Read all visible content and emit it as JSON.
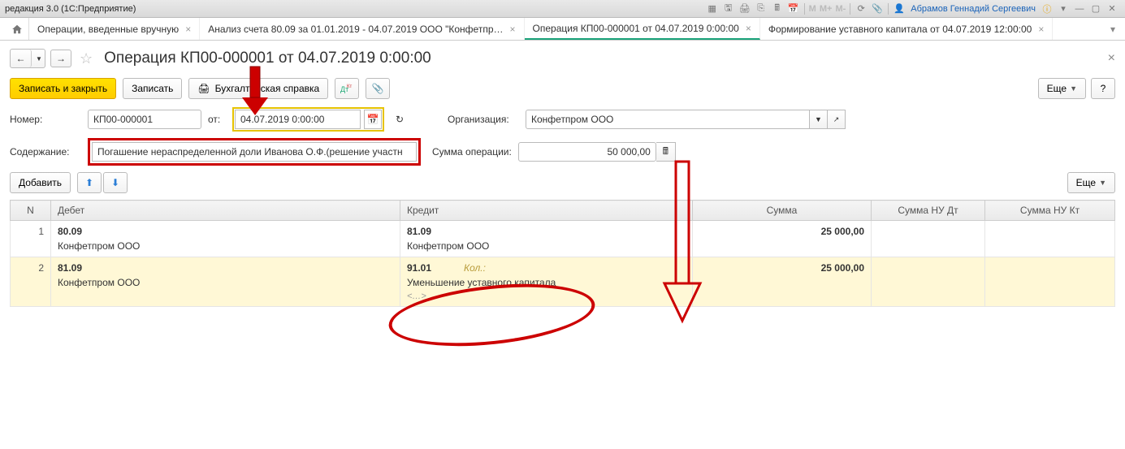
{
  "app": {
    "title": "редакция 3.0 (1С:Предприятие)",
    "user": "Абрамов Геннадий Сергеевич"
  },
  "tabs": {
    "t1": "Операции, введенные вручную",
    "t2": "Анализ счета 80.09 за 01.01.2019 - 04.07.2019 ООО \"Конфетпр…",
    "t3": "Операция КП00-000001 от 04.07.2019 0:00:00",
    "t4": "Формирование уставного капитала от 04.07.2019 12:00:00"
  },
  "page": {
    "title": "Операция КП00-000001 от 04.07.2019 0:00:00"
  },
  "toolbar": {
    "save_close": "Записать и закрыть",
    "save": "Записать",
    "acct_report": "Бухгалтерская справка",
    "more": "Еще"
  },
  "form": {
    "number_label": "Номер:",
    "number_value": "КП00-000001",
    "from_label": "от:",
    "date_value": "04.07.2019  0:00:00",
    "org_label": "Организация:",
    "org_value": "Конфетпром ООО",
    "content_label": "Содержание:",
    "content_value": "Погашение нераспределенной доли Иванова О.Ф.(решение участн",
    "sum_label": "Сумма операции:",
    "sum_value": "50 000,00"
  },
  "tablebar": {
    "add": "Добавить",
    "more": "Еще"
  },
  "columns": {
    "n": "N",
    "debit": "Дебет",
    "credit": "Кредит",
    "sum": "Сумма",
    "sum_nu_dt": "Сумма НУ Дт",
    "sum_nu_kt": "Сумма НУ Кт"
  },
  "rows": [
    {
      "n": "1",
      "debit_acct": "80.09",
      "debit_sub": "Конфетпром ООО",
      "credit_acct": "81.09",
      "credit_sub": "Конфетпром ООО",
      "sum": "25 000,00"
    },
    {
      "n": "2",
      "debit_acct": "81.09",
      "debit_sub": "Конфетпром ООО",
      "credit_acct": "91.01",
      "credit_qty": "Кол.:",
      "credit_sub": "Уменьшение уставного капитала",
      "credit_sub2": "<…>",
      "sum": "25 000,00"
    }
  ]
}
